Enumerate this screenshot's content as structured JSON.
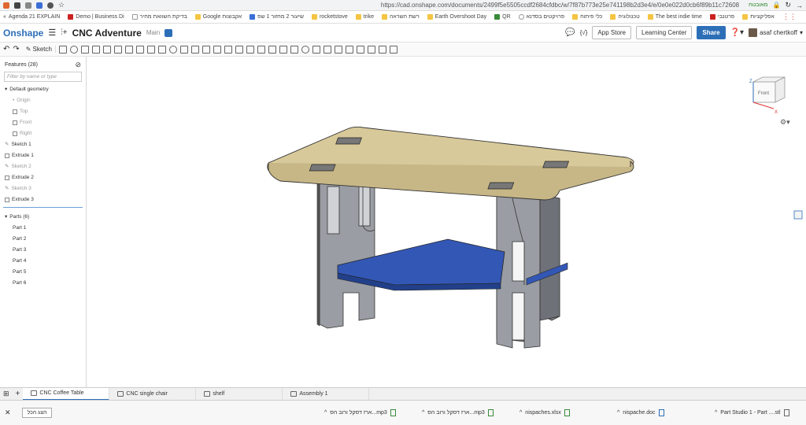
{
  "browser": {
    "url": "https://cad.onshape.com/documents/2499f5e5505ccdf2684cfdbc/w/7f87b773e25e741198b2d3e4/e/0e0e022d0cb6f89b11c72608",
    "lang_label": "מאובטח"
  },
  "bookmarks": [
    "Agenda 21 EXPLAIN",
    "Demo | Business Di",
    "בדיקת השוואת מחיר",
    "Google אקבוצות",
    "שיעור 2 מחזור 1 שפ",
    "rocketstove",
    "trike",
    "רשת השראה",
    "Earth Overshoot Day",
    "QR",
    "פרויקטים בסדנא",
    "כלי פיתוח",
    "טכנולוגיה",
    "The best indie time",
    "פרטנבי",
    "אפליקציות"
  ],
  "appbar": {
    "logo": "Onshape",
    "doc_title": "CNC Adventure",
    "branch": "Main",
    "app_store": "App Store",
    "learning_center": "Learning Center",
    "share": "Share",
    "user": "asaf chertkoff"
  },
  "toolbar": {
    "sketch": "Sketch"
  },
  "features": {
    "header": "Features (28)",
    "filter_placeholder": "Filter by name or type",
    "default_geometry": "Default geometry",
    "geometry": [
      "Origin",
      "Top",
      "Front",
      "Right"
    ],
    "items": [
      "Sketch 1",
      "Extrude 1",
      "Sketch 2",
      "Extrude 2",
      "Sketch 3",
      "Extrude 3"
    ],
    "parts_header": "Parts (6)",
    "parts": [
      "Part 1",
      "Part 2",
      "Part 3",
      "Part 4",
      "Part 5",
      "Part 6"
    ]
  },
  "viewcube": {
    "face": "Front",
    "axis_z": "Z",
    "axis_x": "X"
  },
  "tabs": [
    "CNC Coffee Table",
    "CNC single chair",
    "shelf",
    "Assembly 1"
  ],
  "downloads": {
    "show_all": "הצג הכל",
    "files": [
      "ארז דסקל ורוב הס...mp3",
      "ארז דסקל ורוב הס...mp3",
      "nispaches.xlsx",
      "nispache.doc",
      "Part Studio 1 - Part ....stl"
    ]
  },
  "colors": {
    "tabletop": "#d8c99a",
    "legs": "#8a8d93",
    "shelf": "#3357b5",
    "accent": "#2d6fb7"
  }
}
